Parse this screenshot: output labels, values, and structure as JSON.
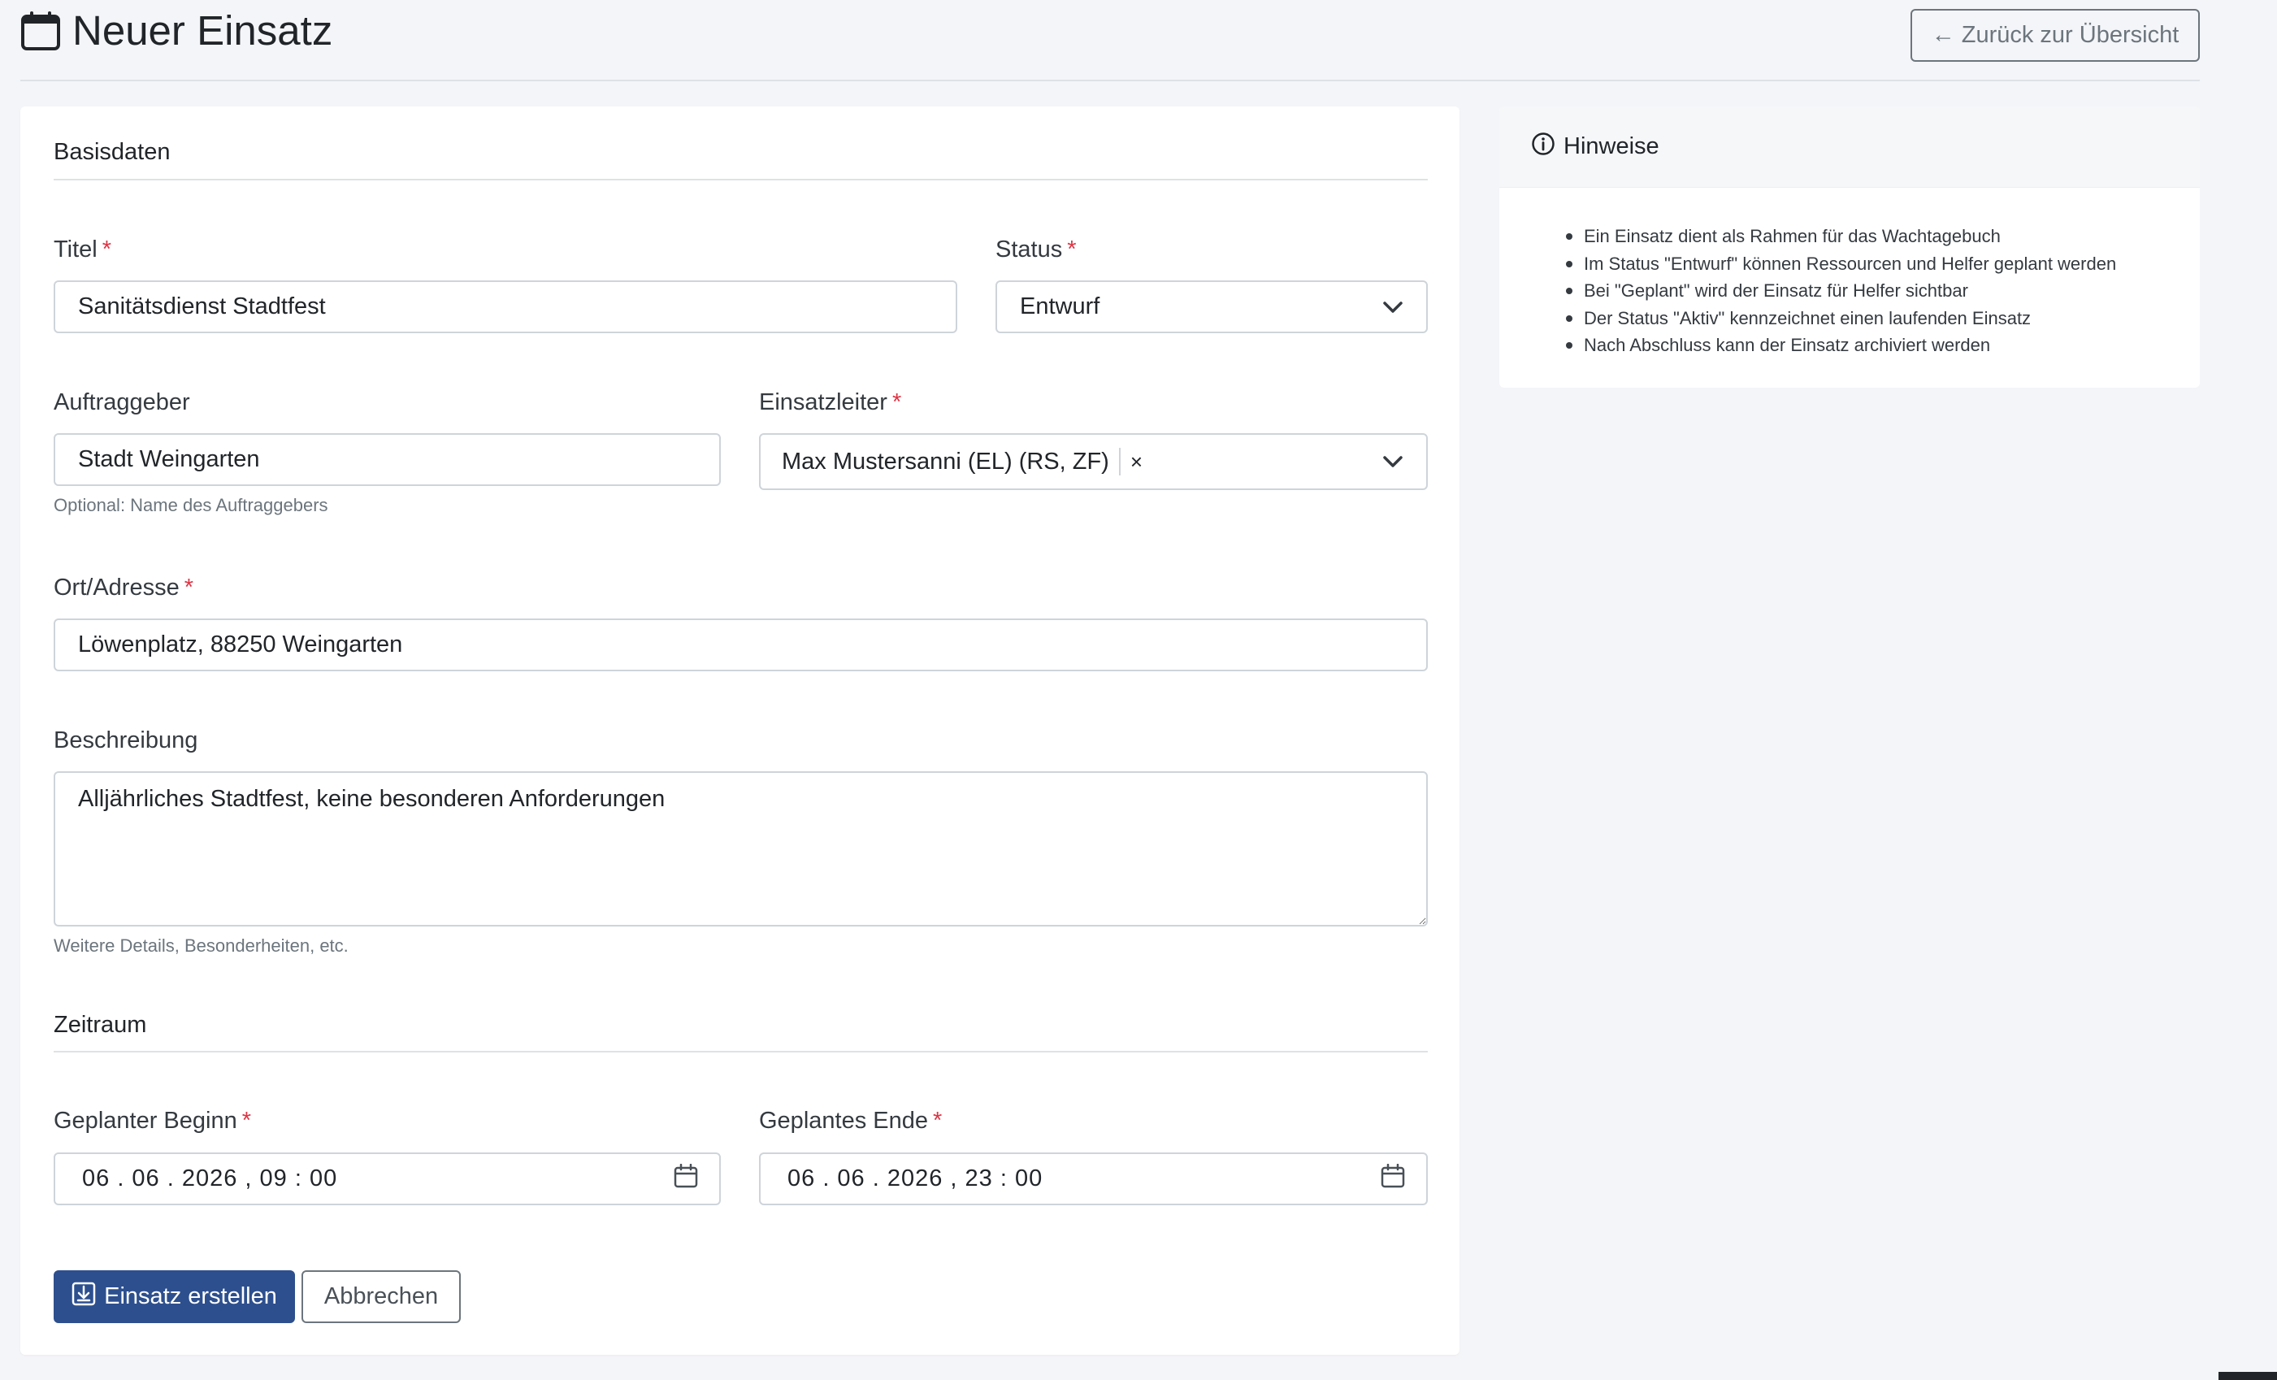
{
  "header": {
    "title": "Neuer Einsatz",
    "back_label": "Zurück zur Übersicht",
    "back_arrow": "←"
  },
  "sections": {
    "basisdaten": "Basisdaten",
    "zeitraum": "Zeitraum"
  },
  "required_mark": "*",
  "fields": {
    "titel": {
      "label": "Titel",
      "value": "Sanitätsdienst Stadtfest"
    },
    "status": {
      "label": "Status",
      "value": "Entwurf"
    },
    "auftraggeber": {
      "label": "Auftraggeber",
      "value": "Stadt Weingarten",
      "help": "Optional: Name des Auftraggebers"
    },
    "einsatzleiter": {
      "label": "Einsatzleiter",
      "value": "Max Mustersanni (EL) (RS, ZF)",
      "remove": "×"
    },
    "ort": {
      "label": "Ort/Adresse",
      "value": "Löwenplatz, 88250 Weingarten"
    },
    "beschreibung": {
      "label": "Beschreibung",
      "value": "Alljährliches Stadtfest, keine besonderen Anforderungen",
      "help": "Weitere Details, Besonderheiten, etc."
    },
    "beginn": {
      "label": "Geplanter Beginn",
      "value": "06 . 06 . 2026 ,  09 : 00"
    },
    "ende": {
      "label": "Geplantes Ende",
      "value": "06 . 06 . 2026 ,  23 : 00"
    }
  },
  "actions": {
    "submit_label": "Einsatz erstellen",
    "cancel_label": "Abbrechen"
  },
  "info": {
    "title": "Hinweise",
    "items": [
      "Ein Einsatz dient als Rahmen für das Wachtagebuch",
      "Im Status \"Entwurf\" können Ressourcen und Helfer geplant werden",
      "Bei \"Geplant\" wird der Einsatz für Helfer sichtbar",
      "Der Status \"Aktiv\" kennzeichnet einen laufenden Einsatz",
      "Nach Abschluss kann der Einsatz archiviert werden"
    ]
  },
  "icons": {
    "page": "calendar-icon",
    "back": "arrow-left-icon",
    "select": "chevron-down-icon",
    "date": "calendar-icon",
    "submit": "save-icon",
    "info": "info-circle-icon"
  },
  "colors": {
    "primary": "#2d4f8e",
    "required": "#dc3545",
    "background": "#f4f5f8",
    "muted": "#6c757d"
  }
}
